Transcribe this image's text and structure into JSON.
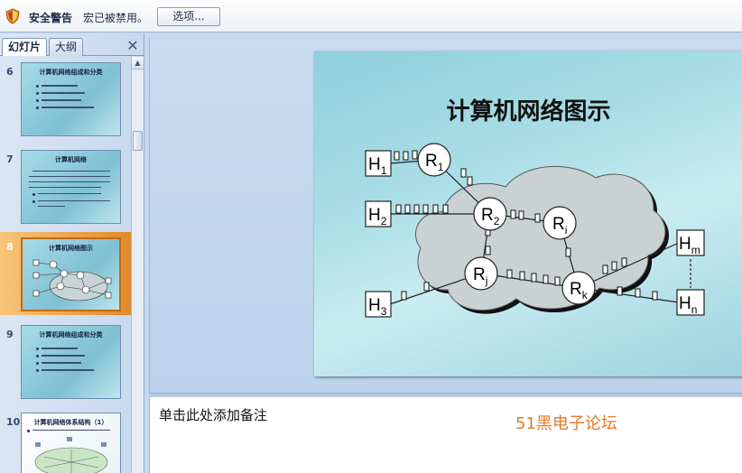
{
  "security_bar": {
    "title": "安全警告",
    "message": "宏已被禁用。",
    "options_button": "选项..."
  },
  "left_pane": {
    "tabs": [
      "幻灯片",
      "大纲"
    ],
    "close_glyph": "✕",
    "scroll_up": "▲",
    "scroll_down": "▼",
    "thumbnails": [
      {
        "number": "6",
        "title": "计算机网络组成和分类",
        "selected": false
      },
      {
        "number": "7",
        "title": "计算机网络",
        "selected": false
      },
      {
        "number": "8",
        "title": "计算机网络图示",
        "selected": true
      },
      {
        "number": "9",
        "title": "计算机网络组成和分类",
        "selected": false
      },
      {
        "number": "10",
        "title": "计算机网络体系结构（1）",
        "selected": false
      }
    ]
  },
  "slide": {
    "title": "计算机网络图示",
    "nodes": {
      "H1": {
        "base": "H",
        "sub": "1"
      },
      "H2": {
        "base": "H",
        "sub": "2"
      },
      "H3": {
        "base": "H",
        "sub": "3"
      },
      "Hm": {
        "base": "H",
        "sub": "m"
      },
      "Hn": {
        "base": "H",
        "sub": "n"
      },
      "R1": {
        "base": "R",
        "sub": "1"
      },
      "R2": {
        "base": "R",
        "sub": "2"
      },
      "Ri": {
        "base": "R",
        "sub": "i"
      },
      "Rj": {
        "base": "R",
        "sub": "j"
      },
      "Rk": {
        "base": "R",
        "sub": "k"
      }
    }
  },
  "notes": {
    "placeholder": "单击此处添加备注",
    "watermark": "51黑电子论坛"
  },
  "colors": {
    "accent": "#e57b25",
    "selection": "#e08a2a"
  }
}
